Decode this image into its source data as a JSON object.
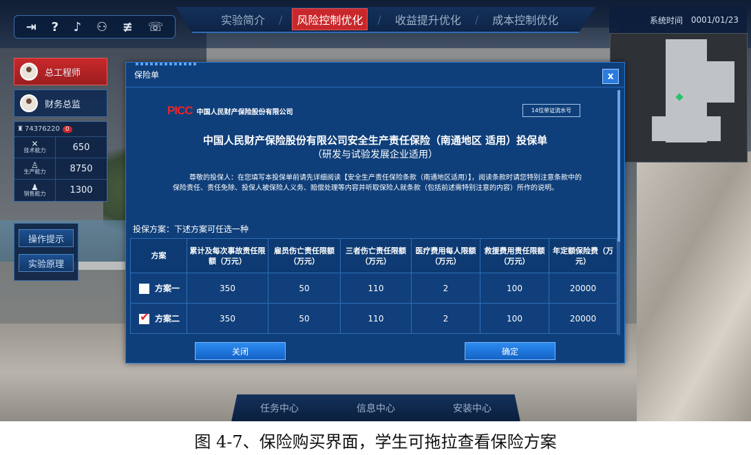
{
  "nav": {
    "tabs": [
      {
        "label": "实验简介"
      },
      {
        "label": "风险控制优化"
      },
      {
        "label": "收益提升优化"
      },
      {
        "label": "成本控制优化"
      }
    ]
  },
  "system": {
    "time_label": "系统时间",
    "time_value": "0001/01/23"
  },
  "roles": [
    {
      "label": "总工程师"
    },
    {
      "label": "财务总监"
    }
  ],
  "stats": {
    "money": "74376220",
    "badge": "0",
    "rows": [
      {
        "name": "技术能力",
        "value": "650"
      },
      {
        "name": "生产能力",
        "value": "8750"
      },
      {
        "name": "销售能力",
        "value": "1300"
      }
    ]
  },
  "help": {
    "tips": "操作提示",
    "principle": "实验原理"
  },
  "bottom_nav": {
    "items": [
      "任务中心",
      "信息中心",
      "安装中心"
    ]
  },
  "dialog": {
    "title": "保险单",
    "close_glyph": "x",
    "logo": "PICC",
    "company": "中国人民财产保险股份有限公司",
    "serial": "14位单证流水号",
    "doc_title": "中国人民财产保险股份有限公司安全生产责任保险（南通地区 适用）投保单",
    "doc_subtitle": "（研发与试验发展企业适用）",
    "notice": "尊敬的投保人：在您填写本投保单前请先详细阅读【安全生产责任保险条款（南通地区适用）】，阅读条款时请您特别注意条款中的保险责任、责任免除、投保人被保险人义务、赔偿处理等内容并听取保险人就条款（包括前述需特别注意的内容）所作的说明。",
    "plan_caption": "投保方案：下述方案可任选一种",
    "table": {
      "headers": [
        "方案",
        "累计及每次事故责任限额（万元）",
        "雇员伤亡责任限额（万元）",
        "三者伤亡责任限额（万元）",
        "医疗费用每人限额（万元）",
        "救援费用责任限额（万元）",
        "年定额保险费（万元）"
      ],
      "rows": [
        {
          "plan": "方案一",
          "checked": false,
          "values": [
            "350",
            "50",
            "110",
            "2",
            "100",
            "20000"
          ]
        },
        {
          "plan": "方案二",
          "checked": true,
          "values": [
            "350",
            "50",
            "110",
            "2",
            "100",
            "20000"
          ]
        }
      ]
    },
    "close_button": "关闭",
    "confirm_button": "确定"
  },
  "caption": "图 4-7、保险购买界面，学生可拖拉查看保险方案",
  "colors": {
    "accent_red": "#c8282b",
    "dialog_blue": "#0f3f7a",
    "button_blue": "#2b8bf0",
    "picc_red": "#e8262b"
  },
  "icons": [
    "logout-icon",
    "help-icon",
    "music-icon",
    "user-icon",
    "settings-icon",
    "headset-icon"
  ]
}
